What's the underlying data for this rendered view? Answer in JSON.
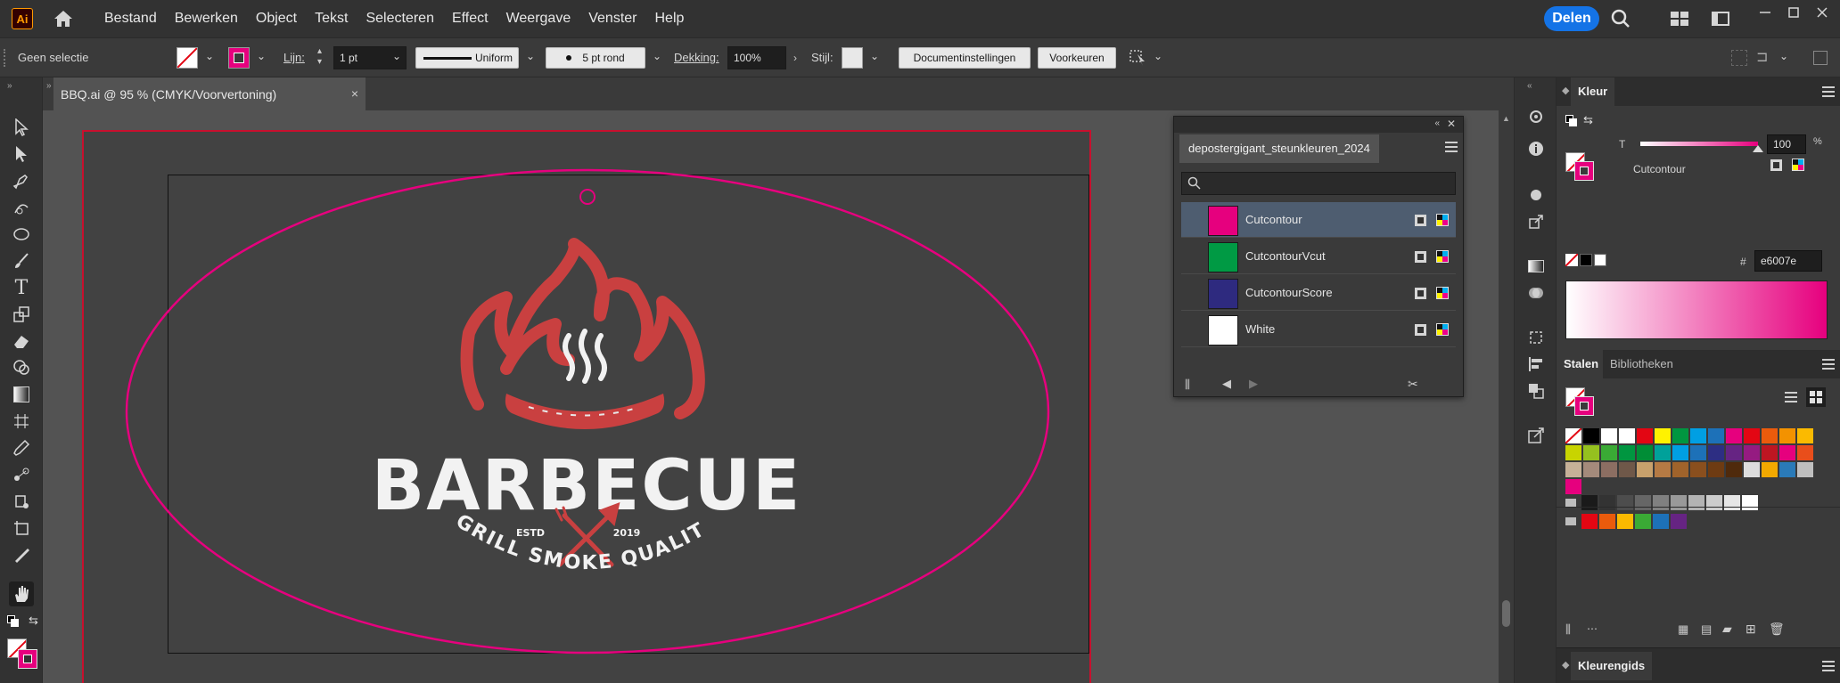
{
  "app": {
    "logo": "Ai",
    "share_label": "Delen"
  },
  "menu": [
    "Bestand",
    "Bewerken",
    "Object",
    "Tekst",
    "Selecteren",
    "Effect",
    "Weergave",
    "Venster",
    "Help"
  ],
  "control_bar": {
    "selection_label": "Geen selectie",
    "stroke_label": "Lijn:",
    "stroke_value": "1 pt",
    "profile_value": "Uniform",
    "brush_value": "5 pt rond",
    "opacity_label": "Dekking:",
    "opacity_value": "100%",
    "style_label": "Stijl:",
    "doc_settings_button": "Documentinstellingen",
    "prefs_button": "Voorkeuren"
  },
  "document_tab": {
    "title": "BBQ.ai @ 95 % (CMYK/Voorvertoning)",
    "close": "×"
  },
  "artwork": {
    "title": "BARBECUE",
    "est_left": "ESTD",
    "est_right": "2019",
    "tagline": "GRILL SMOKE QUALITY",
    "cut_color": "#e6007e",
    "logo_red": "#c94040",
    "logo_white": "#f2f2f2"
  },
  "library_panel": {
    "tab": "depostergigant_steunkleuren_2024",
    "search_placeholder": "",
    "swatches": [
      {
        "name": "Cutcontour",
        "color": "#e6007e",
        "selected": true
      },
      {
        "name": "CutcontourVcut",
        "color": "#009a44",
        "selected": false
      },
      {
        "name": "CutcontourScore",
        "color": "#2e2a7f",
        "selected": false
      },
      {
        "name": "White",
        "color": "#ffffff",
        "selected": false
      }
    ]
  },
  "color_panel": {
    "title": "Kleur",
    "tint_label": "T",
    "tint_value": "100",
    "swatch_name": "Cutcontour",
    "hex_label": "#",
    "hex_value": "e6007e"
  },
  "swatches_panel": {
    "tab_active": "Stalen",
    "tab_inactive": "Bibliotheken",
    "row1": [
      "#ffffff",
      "#000000",
      "#ffffff",
      "#ffffff",
      "#e30613",
      "#fff200",
      "#009640",
      "#009fe3",
      "#1d71b8",
      "#e6007e",
      "#e30613",
      "#ea5b0c",
      "#f39200",
      "#fbba00"
    ],
    "row2": [
      "#c8d400",
      "#95c11f",
      "#3aaa35",
      "#009640",
      "#008d36",
      "#00a19a",
      "#009fe3",
      "#1d71b8",
      "#2d2e83",
      "#662483",
      "#951b81",
      "#be1622",
      "#e6007e",
      "#e94e1b"
    ],
    "row3": [
      "#c6b198",
      "#a48a7b",
      "#8c6e62",
      "#6f5849",
      "#c8a16c",
      "#b57a44",
      "#a0632b",
      "#8a4f1e",
      "#6e3b12",
      "#4f2a0c",
      "#dddddd",
      "#f2a900",
      "#2a7ab8",
      "#bfbfbf"
    ],
    "row4": [
      "#e6007e"
    ],
    "grays": [
      "#1a1a1a",
      "#333333",
      "#4d4d4d",
      "#666666",
      "#808080",
      "#999999",
      "#b3b3b3",
      "#cccccc",
      "#e6e6e6",
      "#ffffff"
    ],
    "brights": [
      "#e30613",
      "#ea5b0c",
      "#fbba00",
      "#3aaa35",
      "#1d71b8",
      "#662483"
    ]
  },
  "bottom_panel": {
    "title": "Kleurengids"
  }
}
